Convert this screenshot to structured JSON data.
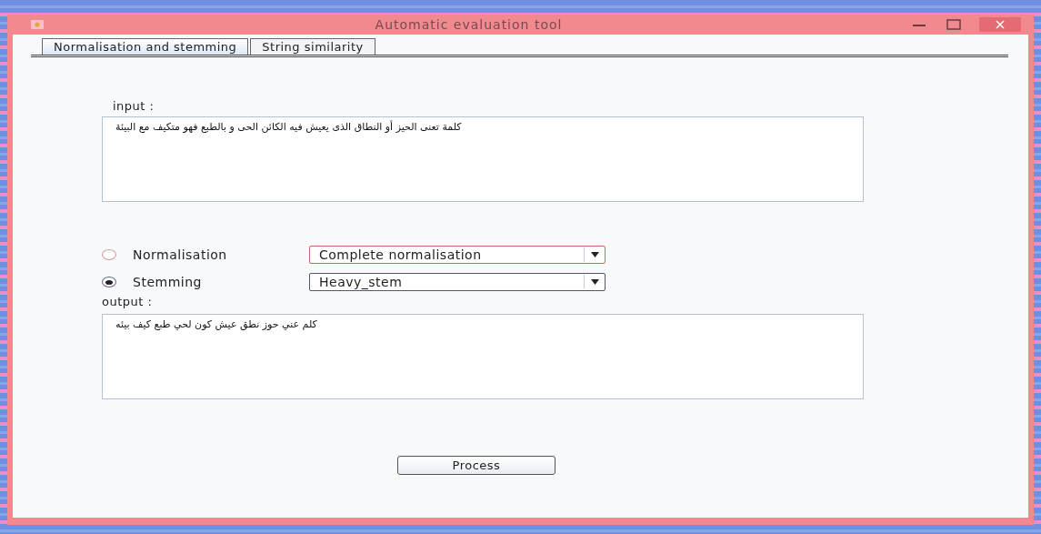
{
  "window": {
    "title": "Automatic evaluation tool"
  },
  "tabs": [
    {
      "label": "Normalisation and stemming",
      "selected": true
    },
    {
      "label": "String similarity",
      "selected": false
    }
  ],
  "input": {
    "label": "input :",
    "value": "كلمة تعنى الحيز أو النطاق الذى يعيش فيه الكائن الحى و بالطبع فهو متكيف مع البيئة"
  },
  "options": [
    {
      "label": "Normalisation",
      "selected": false,
      "dropdown": "Complete normalisation"
    },
    {
      "label": "Stemming",
      "selected": true,
      "dropdown": "Heavy_stem"
    }
  ],
  "output": {
    "label": "output :",
    "value": "كلم عني حوز نطق عيش كون لحي طبع كيف بيئه"
  },
  "buttons": [
    "Process"
  ]
}
